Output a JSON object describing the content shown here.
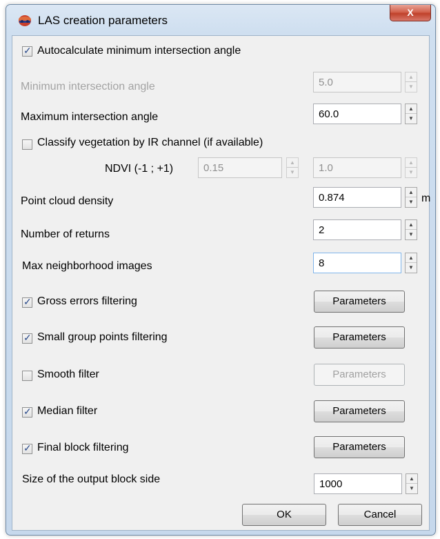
{
  "window": {
    "title": "LAS creation parameters",
    "close_glyph": "X"
  },
  "auto_angle": {
    "label": "Autocalculate minimum intersection angle",
    "checked": true
  },
  "min_angle": {
    "label": "Minimum intersection angle",
    "value": "5.0"
  },
  "max_angle": {
    "label": "Maximum intersection angle",
    "value": "60.0"
  },
  "classify_ir": {
    "label": "Classify vegetation by IR channel (if available)",
    "checked": false
  },
  "ndvi": {
    "label": "NDVI (-1 ; +1)",
    "min_value": "0.15",
    "max_value": "1.0"
  },
  "density": {
    "label": "Point cloud density",
    "value": "0.874",
    "unit": "m"
  },
  "returns": {
    "label": "Number of returns",
    "value": "2"
  },
  "neighborhood": {
    "label": "Max neighborhood images",
    "value": "8"
  },
  "gross_errors": {
    "label": "Gross errors filtering",
    "checked": true,
    "button": "Parameters"
  },
  "small_group": {
    "label": "Small group points filtering",
    "checked": true,
    "button": "Parameters"
  },
  "smooth": {
    "label": "Smooth filter",
    "checked": false,
    "button": "Parameters"
  },
  "median": {
    "label": "Median filter",
    "checked": true,
    "button": "Parameters"
  },
  "final_block": {
    "label": "Final block filtering",
    "checked": true,
    "button": "Parameters"
  },
  "block_side": {
    "label": "Size of the output block side",
    "value": "1000"
  },
  "footer": {
    "ok": "OK",
    "cancel": "Cancel"
  },
  "icons": {
    "check": "✓",
    "spin_up": "▲",
    "spin_down": "▼"
  }
}
